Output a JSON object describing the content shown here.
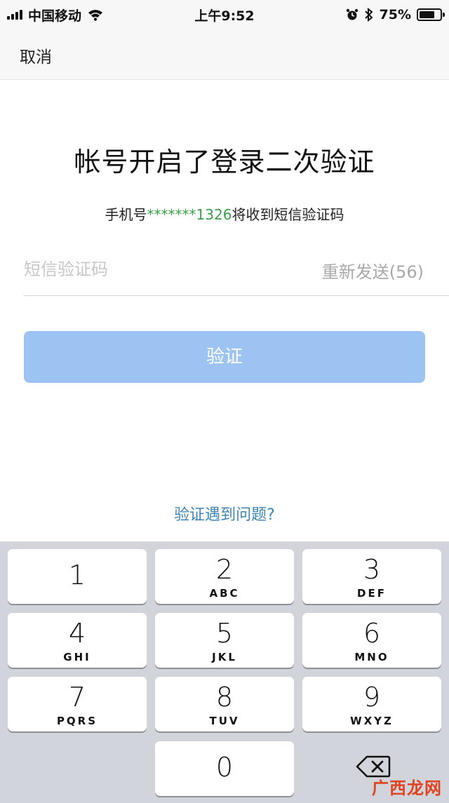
{
  "status_bar": {
    "carrier": "中国移动",
    "time": "上午9:52",
    "battery": "75%",
    "battery_level": 0.75,
    "icons": [
      "signal-icon",
      "wifi-icon",
      "alarm-icon",
      "bluetooth-icon",
      "battery-icon"
    ]
  },
  "nav": {
    "cancel": "取消"
  },
  "main": {
    "title": "帐号开启了登录二次验证",
    "hint_prefix": "手机号",
    "phone": "*******1326",
    "hint_suffix": "将收到短信验证码",
    "code_placeholder": "短信验证码",
    "code_value": "",
    "resend": "重新发送(56)",
    "verify": "验证",
    "problem_link": "验证遇到问题?"
  },
  "keyboard": {
    "keys": [
      {
        "num": "1",
        "letters": ""
      },
      {
        "num": "2",
        "letters": "ABC"
      },
      {
        "num": "3",
        "letters": "DEF"
      },
      {
        "num": "4",
        "letters": "GHI"
      },
      {
        "num": "5",
        "letters": "JKL"
      },
      {
        "num": "6",
        "letters": "MNO"
      },
      {
        "num": "7",
        "letters": "PQRS"
      },
      {
        "num": "8",
        "letters": "TUV"
      },
      {
        "num": "9",
        "letters": "WXYZ"
      },
      {
        "num": "0",
        "letters": ""
      }
    ]
  },
  "colors": {
    "phone_green": "#3aa34a",
    "link_blue": "#3e85b6",
    "button_blue": "#9dc3f3",
    "keyboard_bg": "#d1d4da"
  },
  "watermark": "广西龙网"
}
